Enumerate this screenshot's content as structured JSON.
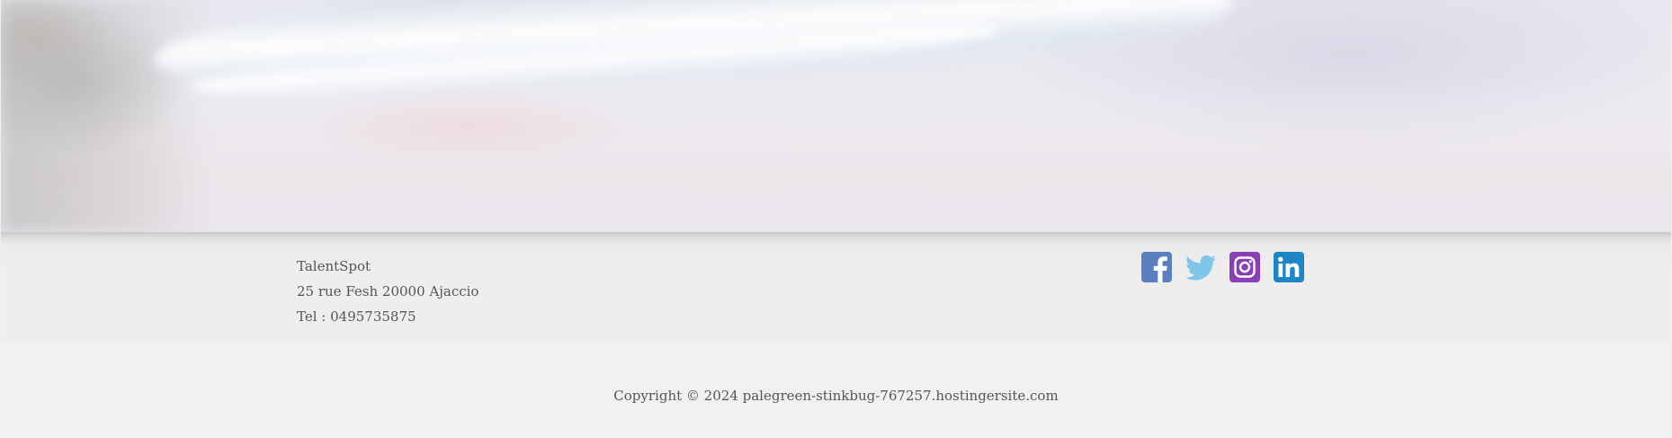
{
  "footer": {
    "contact": {
      "company": "TalentSpot",
      "address": "25 rue Fesh 20000 Ajaccio",
      "phone": "Tel : 0495735875"
    },
    "socials": [
      {
        "icon": "facebook-icon",
        "color": "#5b7fbf"
      },
      {
        "icon": "twitter-icon",
        "color": "#7fc6e8"
      },
      {
        "icon": "instagram-icon",
        "color": "#8a3fb5"
      },
      {
        "icon": "linkedin-icon",
        "color": "#1f86c6"
      }
    ]
  },
  "copyright": {
    "text": "Copyright © 2024 palegreen-stinkbug-767257.hostingersite.com"
  }
}
